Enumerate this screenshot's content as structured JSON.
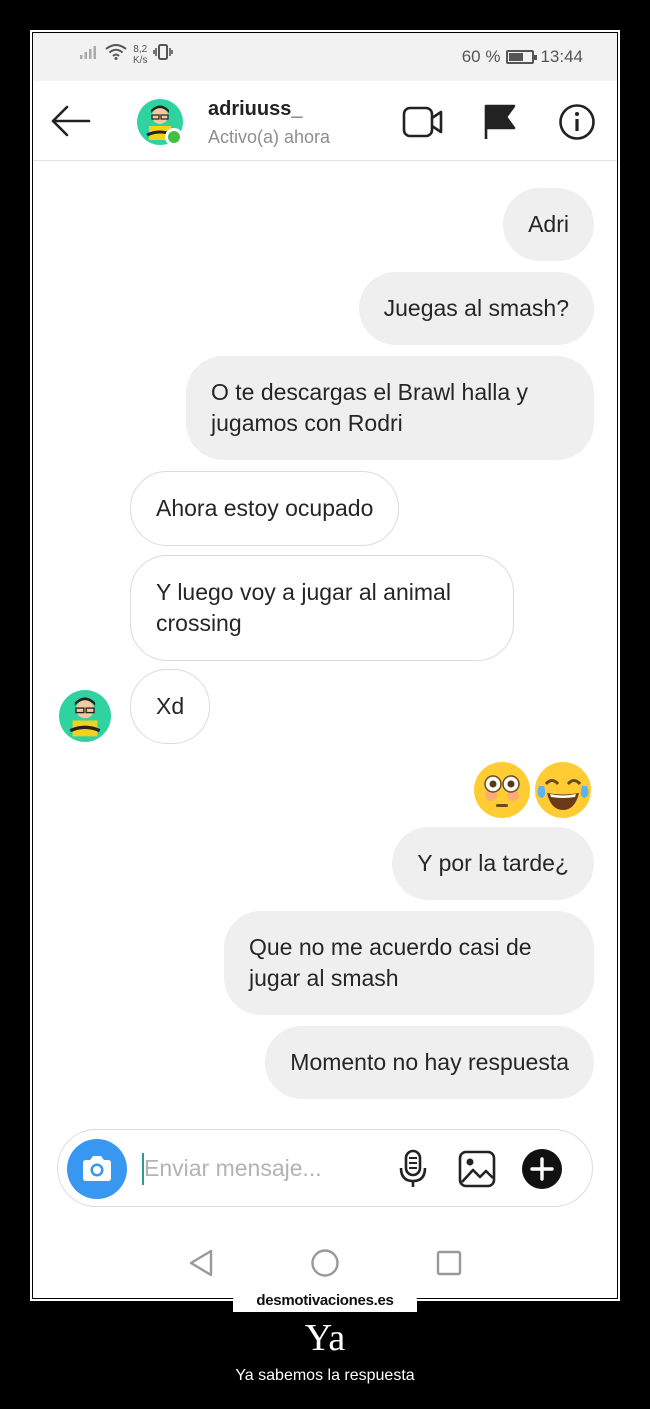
{
  "status_bar": {
    "net_speed_value": "8,2",
    "net_speed_unit": "K/s",
    "battery_percent": "60 %",
    "battery_level": 0.6,
    "time": "13:44"
  },
  "header": {
    "username": "adriuuss_",
    "activity": "Activo(a) ahora",
    "icons": [
      "back-arrow",
      "video-camera",
      "flag",
      "info"
    ]
  },
  "messages": [
    {
      "from": "me",
      "text": "Adri"
    },
    {
      "from": "me",
      "text": "Juegas al smash?"
    },
    {
      "from": "me",
      "text": "O te descargas el Brawl halla y jugamos con Rodri"
    },
    {
      "from": "them",
      "text": "Ahora estoy ocupado"
    },
    {
      "from": "them",
      "text": "Y luego voy a jugar al animal crossing"
    },
    {
      "from": "them",
      "text": "Xd"
    },
    {
      "from": "me",
      "emoji": [
        "flushed-face",
        "tears-of-joy-face"
      ]
    },
    {
      "from": "me",
      "text": "Y por la tarde¿"
    },
    {
      "from": "me",
      "text": "Que no me acuerdo casi de jugar al smash"
    },
    {
      "from": "me",
      "text": "Momento no hay respuesta"
    }
  ],
  "composer": {
    "placeholder": "Enviar mensaje...",
    "value": "",
    "icons": [
      "camera",
      "microphone",
      "gallery",
      "plus"
    ]
  },
  "colors": {
    "accent_blue": "#3897f0",
    "online_green": "#3fc13f",
    "sent_bubble": "#efefef",
    "received_border": "#dbdbdb",
    "avatar_bg": "#2fd3a0"
  },
  "caption": {
    "watermark": "desmotivaciones.es",
    "title": "Ya",
    "subtitle": "Ya sabemos la respuesta"
  }
}
